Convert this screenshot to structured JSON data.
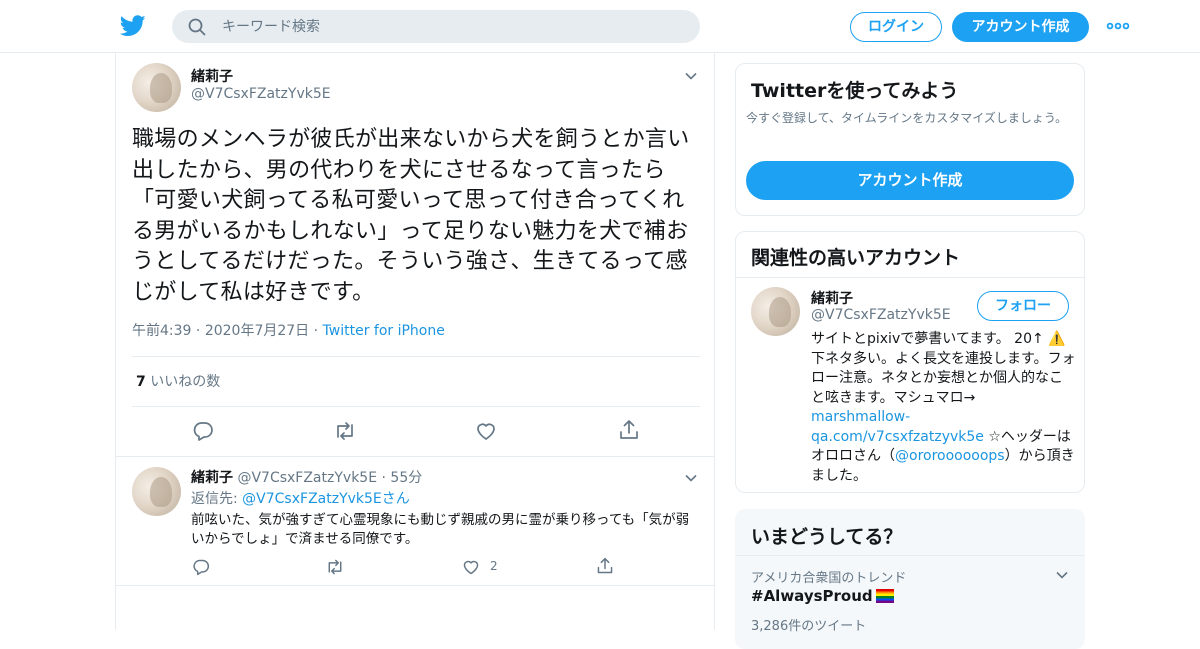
{
  "header": {
    "search_placeholder": "キーワード検索",
    "login_label": "ログイン",
    "signup_label": "アカウント作成"
  },
  "tweet": {
    "author_name": "緒莉子",
    "author_handle": "@V7CsxFZatzYvk5E",
    "text": "職場のメンヘラが彼氏が出来ないから犬を飼うとか言い出したから、男の代わりを犬にさせるなって言ったら「可愛い犬飼ってる私可愛いって思って付き合ってくれる男がいるかもしれない」って足りない魅力を犬で補おうとしてるだけだった。そういう強さ、生きてるって感じがして私は好きです。",
    "time": "午前4:39",
    "date": "2020年7月27日",
    "source": "Twitter for iPhone",
    "likes_count": "7",
    "likes_label": "いいねの数"
  },
  "reply": {
    "author_name": "緒莉子",
    "author_handle": "@V7CsxFZatzYvk5E",
    "age": "55分",
    "reply_to_prefix": "返信先:",
    "reply_to_handle": "@V7CsxFZatzYvk5E",
    "reply_to_suffix": "さん",
    "text": "前呟いた、気が強すぎて心霊現象にも動じず親戚の男に霊が乗り移っても「気が弱いからでしょ」で済ませる同僚です。",
    "like_count": "2"
  },
  "sidebar": {
    "signup_card": {
      "title": "Twitterを使ってみよう",
      "subtitle": "今すぐ登録して、タイムラインをカスタマイズしましょう。",
      "button_label": "アカウント作成"
    },
    "related_card": {
      "title": "関連性の高いアカウント",
      "name": "緒莉子",
      "handle": "@V7CsxFZatzYvk5E",
      "follow_label": "フォロー",
      "bio_1": "サイトとpixivで夢書いてます。 20↑ ⚠️下ネタ多い。よく長文を連投します。フォロー注意。ネタとか妄想とか個人的なこと呟きます。マシュマロ→",
      "bio_link": "marshmallow-qa.com/v7csxfzatzyvk5e",
      "bio_2": "☆ヘッダーはオロロさん（",
      "bio_mention": "@ororoooooops",
      "bio_3": "）から頂きました。"
    },
    "trends_card": {
      "title": "いまどうしてる？",
      "location": "アメリカ合衆国のトレンド",
      "hashtag": "#AlwaysProud",
      "count": "3,286件のツイート"
    }
  },
  "colors": {
    "accent": "#1da1f2",
    "link": "#1b95e0",
    "muted": "#657786",
    "border": "#e6ecf0"
  },
  "icons": [
    "twitter-bird-icon",
    "search-icon",
    "more-dots-icon",
    "chevron-down-icon",
    "reply-icon",
    "retweet-icon",
    "like-icon",
    "share-icon",
    "rainbow-flag-icon"
  ]
}
